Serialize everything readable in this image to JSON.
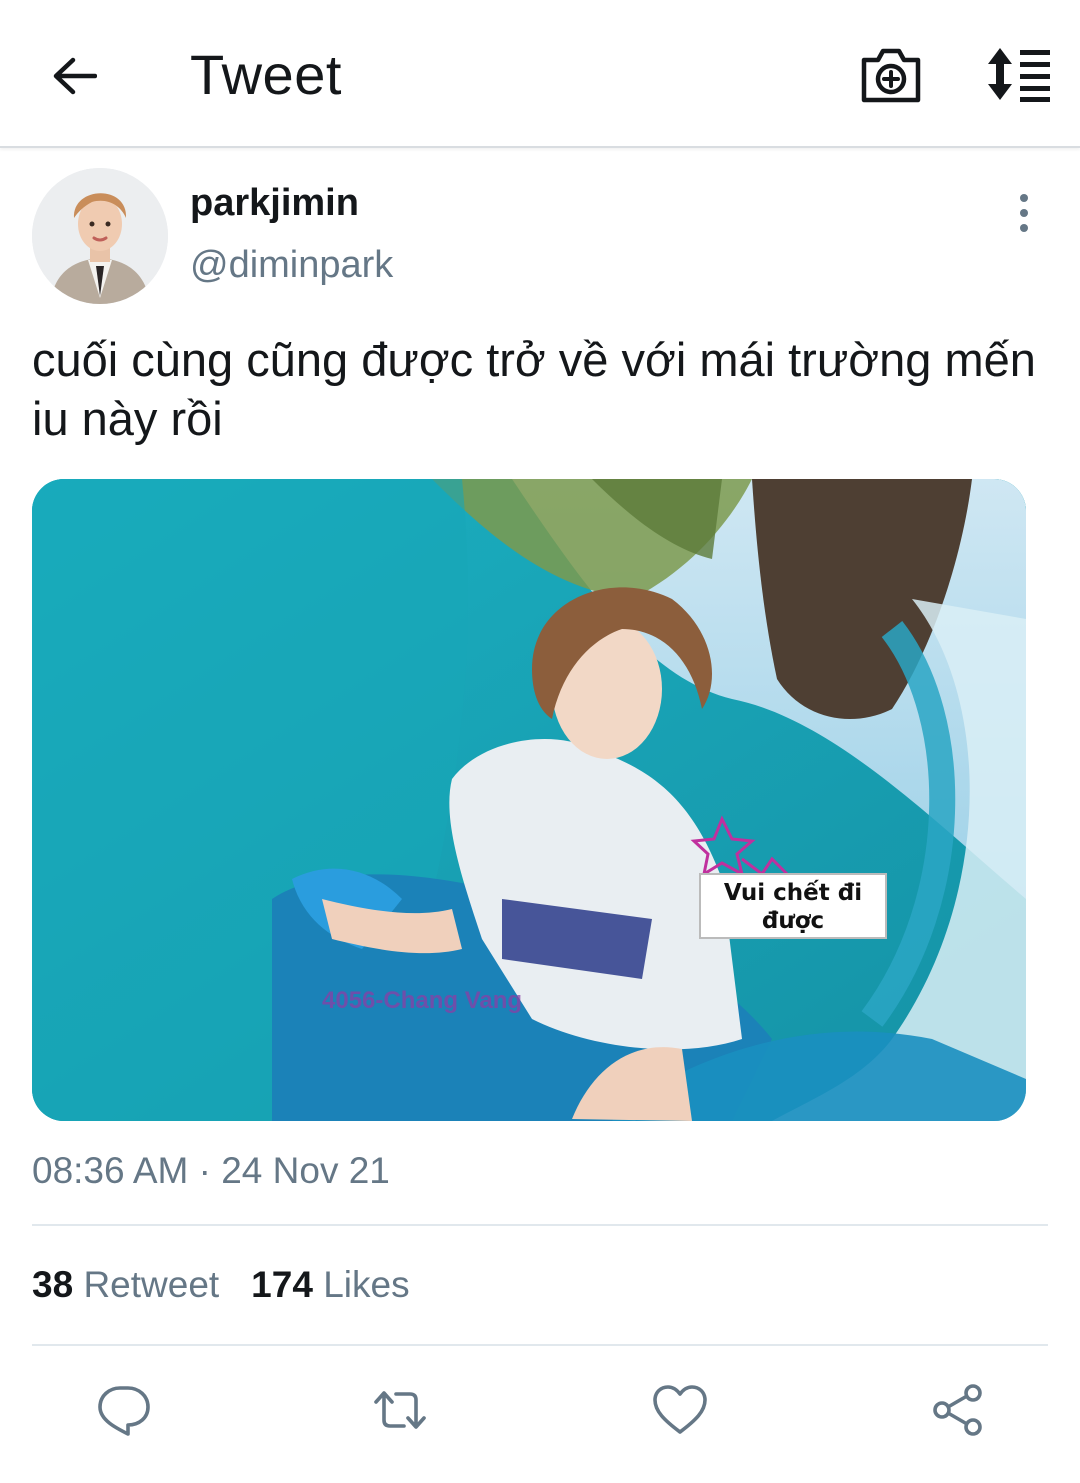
{
  "header": {
    "title": "Tweet",
    "back_icon": "arrow-left-icon",
    "camera_icon": "camera-plus-icon",
    "sort_icon": "sort-list-icon"
  },
  "tweet": {
    "display_name": "parkjimin",
    "handle": "@diminpark",
    "text": "cuối cùng cũng được trở về với mái trường mến iu này rồi",
    "media": {
      "caption": "Vui chết đi được",
      "watermark": "4056-Chang Vang"
    },
    "timestamp": "08:36 AM · 24 Nov 21"
  },
  "stats": {
    "retweets_count": "38",
    "retweets_label": "Retweet",
    "likes_count": "174",
    "likes_label": "Likes"
  },
  "actions": {
    "reply_icon": "reply-icon",
    "retweet_icon": "retweet-icon",
    "like_icon": "heart-icon",
    "share_icon": "share-icon"
  },
  "colors": {
    "text_primary": "#14171a",
    "text_secondary": "#657786",
    "divider": "#e1e8ed",
    "icon": "#657786"
  }
}
